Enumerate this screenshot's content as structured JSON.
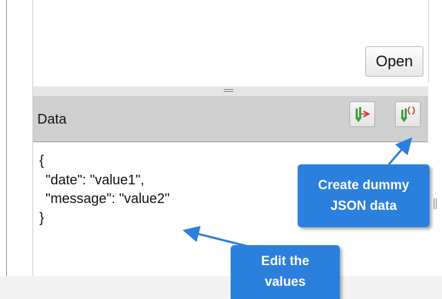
{
  "open_button": {
    "label": "Open"
  },
  "data_panel": {
    "title": "Data",
    "toolbar": [
      {
        "icon": "insert-data-icon"
      },
      {
        "icon": "json-braces-icon"
      }
    ]
  },
  "editor": {
    "lines": [
      "{",
      "\"date\": \"value1\",",
      "\"message\": \"value2\"",
      "}"
    ]
  },
  "callouts": {
    "create_json": {
      "line1": "Create dummy",
      "line2": "JSON data"
    },
    "edit_values": {
      "line1": "Edit the",
      "line2": "values"
    }
  },
  "colors": {
    "callout": "#2b7fdd",
    "icon_green": "#3aa13a",
    "icon_red": "#d23030"
  }
}
